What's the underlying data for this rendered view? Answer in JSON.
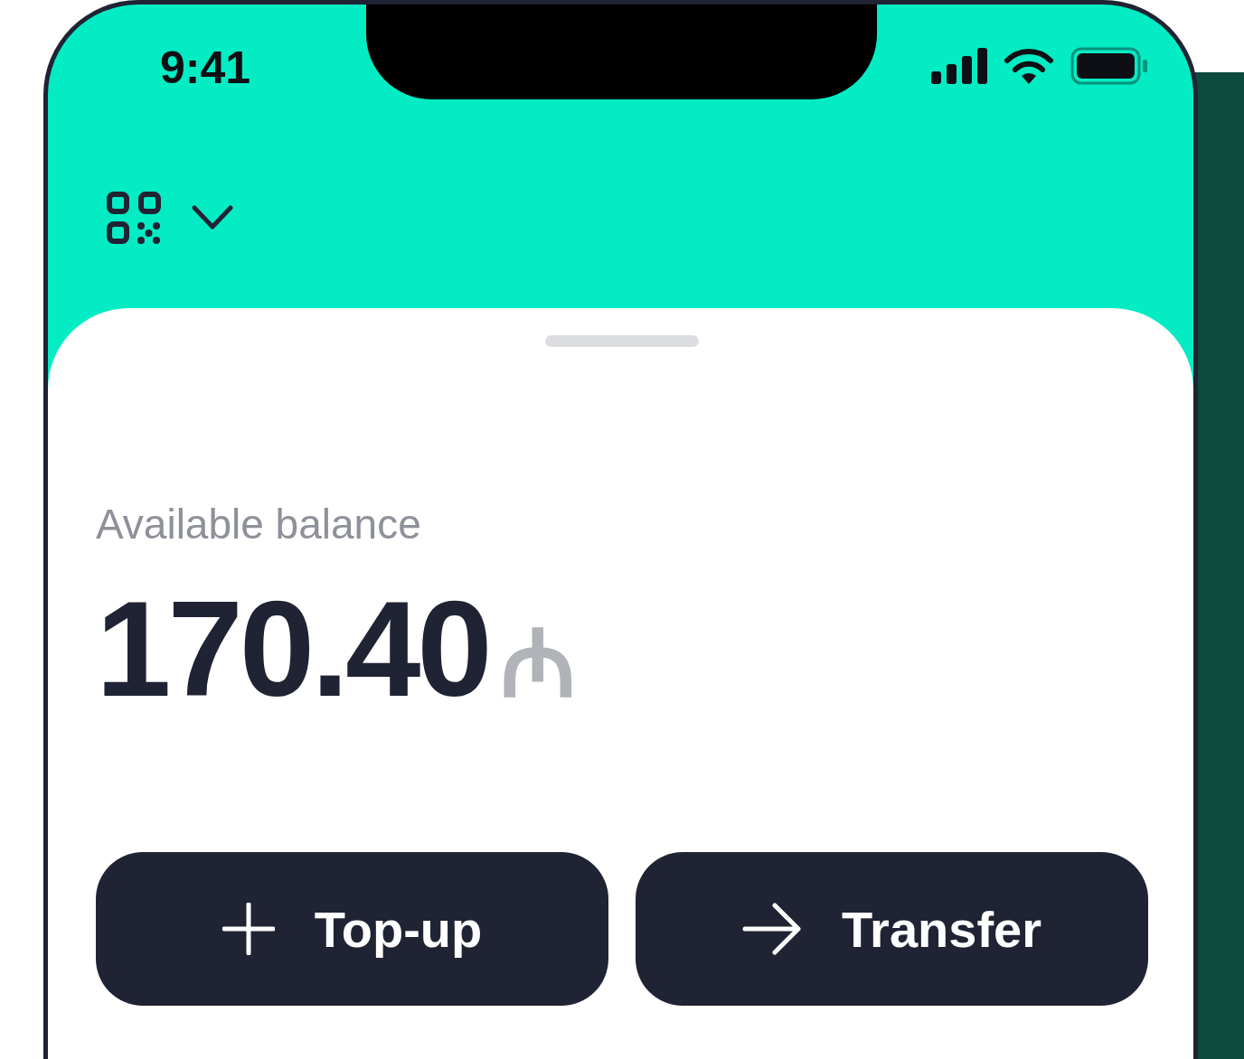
{
  "status_bar": {
    "time": "9:41"
  },
  "balance": {
    "label": "Available balance",
    "amount": "170.40",
    "currency": "₼"
  },
  "actions": [
    {
      "label": "Top-up",
      "kind": "topup"
    },
    {
      "label": "Transfer",
      "kind": "transfer"
    }
  ]
}
